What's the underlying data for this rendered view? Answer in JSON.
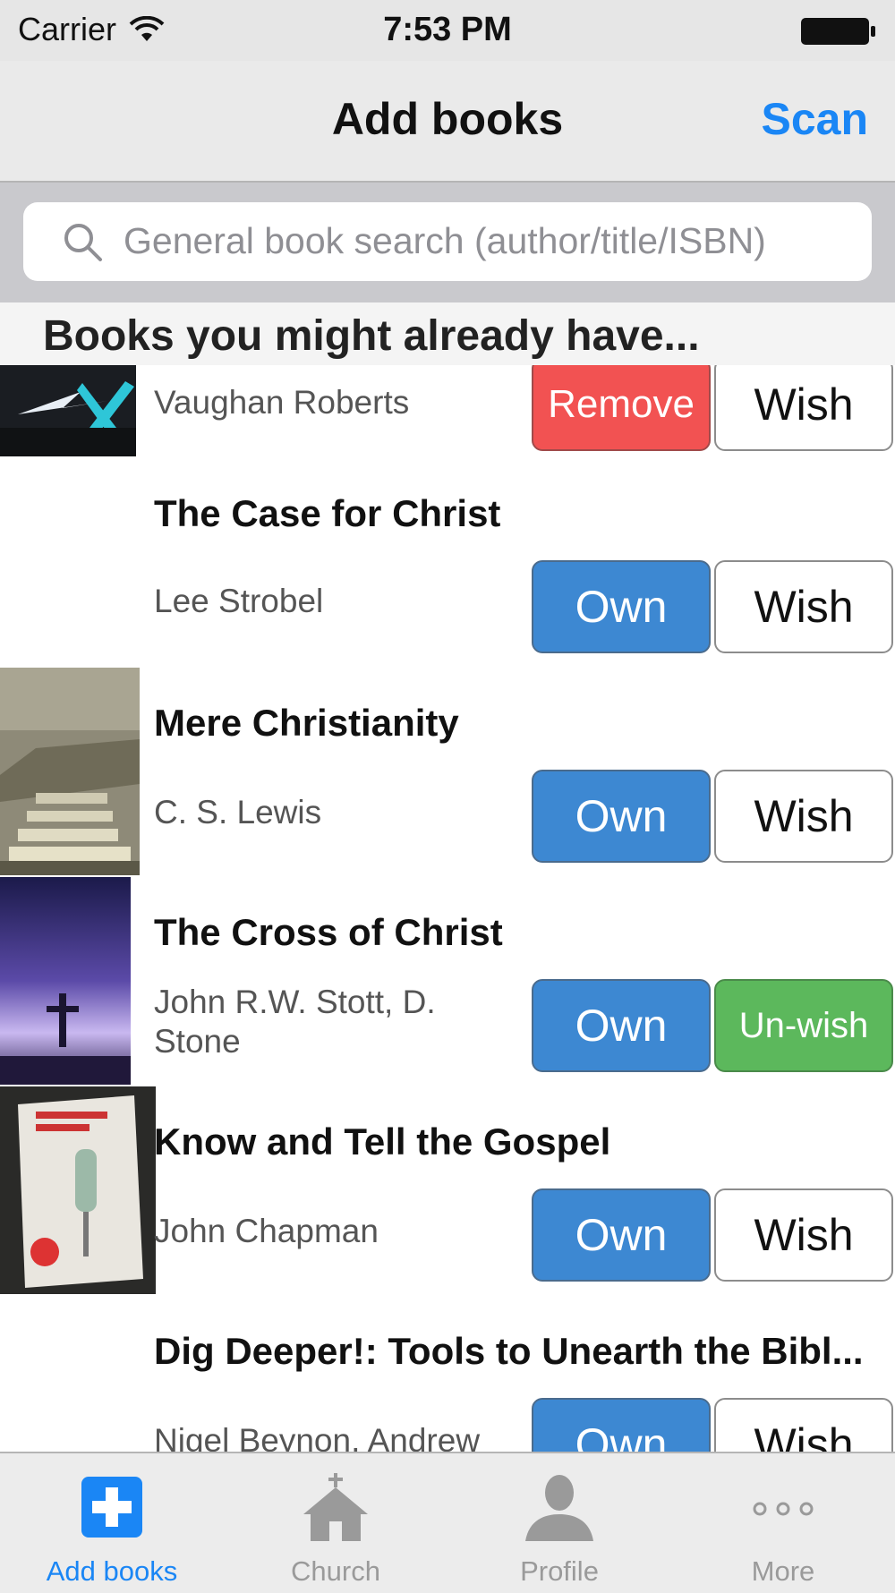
{
  "status_bar": {
    "carrier": "Carrier",
    "time": "7:53 PM"
  },
  "nav": {
    "title": "Add books",
    "scan_label": "Scan"
  },
  "search": {
    "placeholder": "General book search (author/title/ISBN)"
  },
  "section": {
    "header": "Books you might already have..."
  },
  "books": [
    {
      "title": "",
      "author": "Vaughan Roberts",
      "own_label": "Remove",
      "own_state": "owned",
      "wish_label": "Wish",
      "wish_state": "not-wished",
      "cover": "blue-x-cover"
    },
    {
      "title": "The Case for Christ",
      "author": "Lee Strobel",
      "own_label": "Own",
      "own_state": "not-owned",
      "wish_label": "Wish",
      "wish_state": "not-wished",
      "cover": "none"
    },
    {
      "title": "Mere Christianity",
      "author": "C. S. Lewis",
      "own_label": "Own",
      "own_state": "not-owned",
      "wish_label": "Wish",
      "wish_state": "not-wished",
      "cover": "stairs-cover"
    },
    {
      "title": "The Cross of Christ",
      "author": "John R.W. Stott, D. Stone",
      "own_label": "Own",
      "own_state": "not-owned",
      "wish_label": "Un-wish",
      "wish_state": "wished",
      "cover": "purple-sky-cover"
    },
    {
      "title": "Know and Tell the Gospel",
      "author": "John Chapman",
      "own_label": "Own",
      "own_state": "not-owned",
      "wish_label": "Wish",
      "wish_state": "not-wished",
      "cover": "microphone-cover"
    },
    {
      "title": "Dig Deeper!: Tools to Unearth the Bibl...",
      "author": "Nigel Beynon, Andrew",
      "own_label": "Own",
      "own_state": "not-owned",
      "wish_label": "Wish",
      "wish_state": "not-wished",
      "cover": "none"
    }
  ],
  "tabs": [
    {
      "label": "Add books",
      "icon": "plus-icon",
      "active": true
    },
    {
      "label": "Church",
      "icon": "church-icon",
      "active": false
    },
    {
      "label": "Profile",
      "icon": "person-icon",
      "active": false
    },
    {
      "label": "More",
      "icon": "more-icon",
      "active": false
    }
  ],
  "colors": {
    "accent": "#1a86f5",
    "own": "#3d88d2",
    "remove": "#f25252",
    "unwish": "#5cb85c"
  }
}
